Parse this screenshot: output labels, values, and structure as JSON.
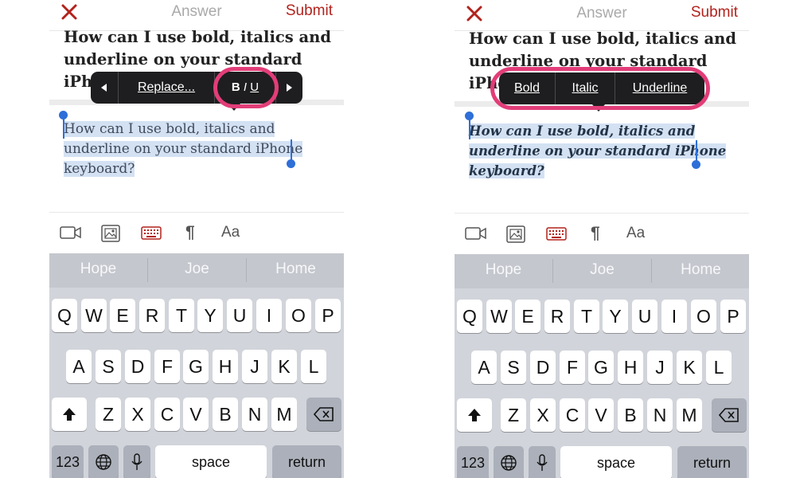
{
  "header": {
    "close_icon": "close-icon",
    "title": "Answer",
    "submit": "Submit"
  },
  "question": "How can I use bold, italics and underline on your standard iPhone keyboard?",
  "answer_text": "How can I use bold, italics and underline on your standard iPhone keyboard?",
  "panel1": {
    "menu": {
      "replace": "Replace...",
      "biu": "BIU"
    }
  },
  "panel2": {
    "menu": {
      "bold": "Bold",
      "italic": "Italic",
      "underline": "Underline"
    }
  },
  "toolbar": [
    "video-icon",
    "image-icon",
    "keyboard-icon",
    "paragraph-icon",
    "font-size-icon"
  ],
  "toolbar_labels": {
    "pilcrow": "¶",
    "aa": "Aa"
  },
  "suggestions": [
    "Hope",
    "Joe",
    "Home"
  ],
  "keyboard": {
    "row1": [
      "Q",
      "W",
      "E",
      "R",
      "T",
      "Y",
      "U",
      "I",
      "O",
      "P"
    ],
    "row2": [
      "A",
      "S",
      "D",
      "F",
      "G",
      "H",
      "J",
      "K",
      "L"
    ],
    "row3": [
      "Z",
      "X",
      "C",
      "V",
      "B",
      "N",
      "M"
    ],
    "numbers": "123",
    "space": "space",
    "return": "return"
  },
  "colors": {
    "accent_red": "#b2231d",
    "highlight_ring": "#e23d78",
    "selection": "#d3e1f3",
    "caret": "#2e6fd8"
  }
}
